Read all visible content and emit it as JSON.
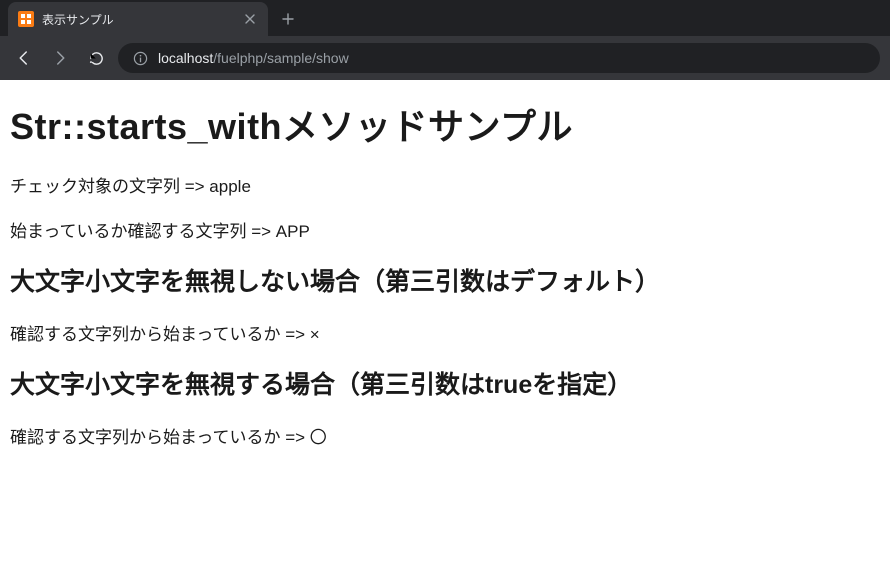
{
  "browser": {
    "tab": {
      "title": "表示サンプル"
    },
    "url": {
      "host": "localhost",
      "path": "/fuelphp/sample/show"
    }
  },
  "content": {
    "h1": "Str::starts_withメソッドサンプル",
    "p1": "チェック対象の文字列 => apple",
    "p2": "始まっているか確認する文字列 => APP",
    "h2a": "大文字小文字を無視しない場合（第三引数はデフォルト）",
    "p3": "確認する文字列から始まっているか => ×",
    "h2b": "大文字小文字を無視する場合（第三引数はtrueを指定）",
    "p4": "確認する文字列から始まっているか => 〇"
  }
}
